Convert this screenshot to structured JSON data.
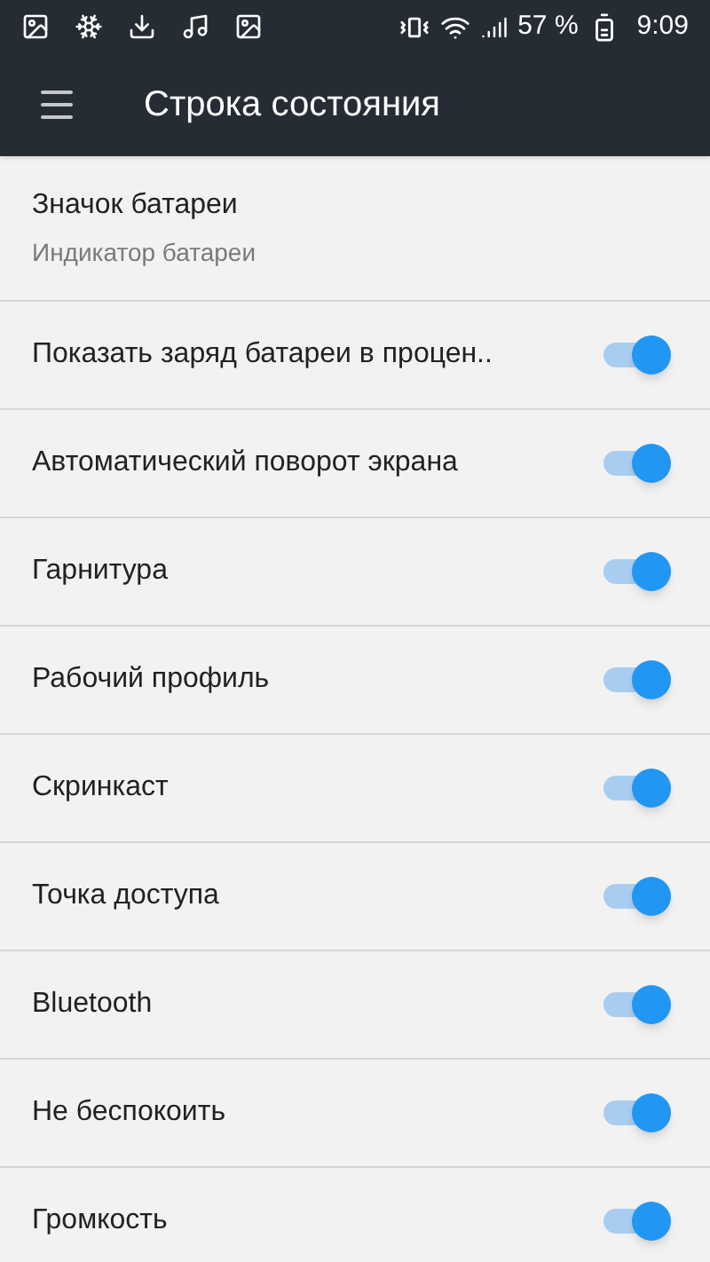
{
  "status_bar": {
    "battery": "57 %",
    "time": "9:09"
  },
  "toolbar": {
    "title": "Строка состояния"
  },
  "header_item": {
    "title": "Значок батареи",
    "subtitle": "Индикатор батареи"
  },
  "items": [
    {
      "label": "Показать заряд батареи в процен..",
      "on": true
    },
    {
      "label": "Автоматический поворот экрана",
      "on": true
    },
    {
      "label": "Гарнитура",
      "on": true
    },
    {
      "label": "Рабочий профиль",
      "on": true
    },
    {
      "label": "Скринкаст",
      "on": true
    },
    {
      "label": "Точка доступа",
      "on": true
    },
    {
      "label": "Bluetooth",
      "on": true
    },
    {
      "label": "Не беспокоить",
      "on": true
    },
    {
      "label": "Громкость",
      "on": true
    }
  ]
}
